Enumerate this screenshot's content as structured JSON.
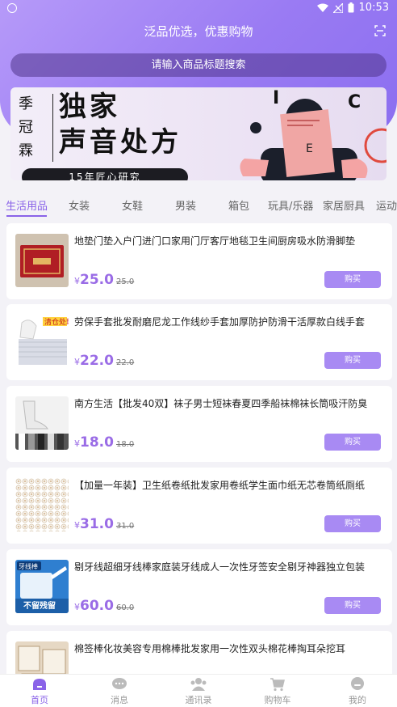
{
  "status_bar": {
    "time": "10:53"
  },
  "header": {
    "title": "泛品优选，优惠购物"
  },
  "search": {
    "placeholder": "请输入商品标题搜索"
  },
  "banner": {
    "side_text": [
      "季",
      "冠",
      "霖"
    ],
    "headline_1": "独家",
    "headline_2": "声音处方",
    "pill": "15年匠心研究",
    "art_letters": [
      "I",
      "C",
      "E"
    ]
  },
  "tabs": [
    {
      "label": "生活用品",
      "active": true
    },
    {
      "label": "女装"
    },
    {
      "label": "女鞋"
    },
    {
      "label": "男装"
    },
    {
      "label": "箱包"
    },
    {
      "label": "玩具/乐器"
    },
    {
      "label": "家居厨具"
    },
    {
      "label": "运动"
    }
  ],
  "currency": "¥",
  "buy_label": "购买",
  "products": [
    {
      "name": "地垫门垫入户门进门口家用门厅客厅地毯卫生间厨房吸水防滑脚垫",
      "price": "25.0",
      "original": "25.0"
    },
    {
      "name": "劳保手套批发耐磨尼龙工作线纱手套加厚防护防滑干活厚款白线手套",
      "price": "22.0",
      "original": "22.0",
      "thumb_tag": "清仓处理"
    },
    {
      "name": "南方生活【批发40双】袜子男士短袜春夏四季船袜棉袜长筒吸汗防臭",
      "price": "18.0",
      "original": "18.0"
    },
    {
      "name": "【加量一年装】卫生纸卷纸批发家用卷纸学生面巾纸无芯卷筒纸厕纸",
      "price": "31.0",
      "original": "31.0"
    },
    {
      "name": "剔牙线超细牙线棒家庭装牙线成人一次性牙签安全剔牙神器独立包装",
      "price": "60.0",
      "original": "60.0",
      "thumb_tag": "牙线棒",
      "thumb_tag2": "不留残留"
    },
    {
      "name": "棉签棒化妆美容专用棉棒批发家用一次性双头棉花棒掏耳朵挖耳",
      "price": "",
      "original": ""
    }
  ],
  "bottom_nav": [
    {
      "label": "首页",
      "active": true
    },
    {
      "label": "消息"
    },
    {
      "label": "通讯录"
    },
    {
      "label": "购物车"
    },
    {
      "label": "我的"
    }
  ],
  "colors": {
    "accent": "#8a63e8",
    "hero_start": "#b69af9",
    "hero_end": "#8b6ef0",
    "buy_button": "#a88af3"
  }
}
